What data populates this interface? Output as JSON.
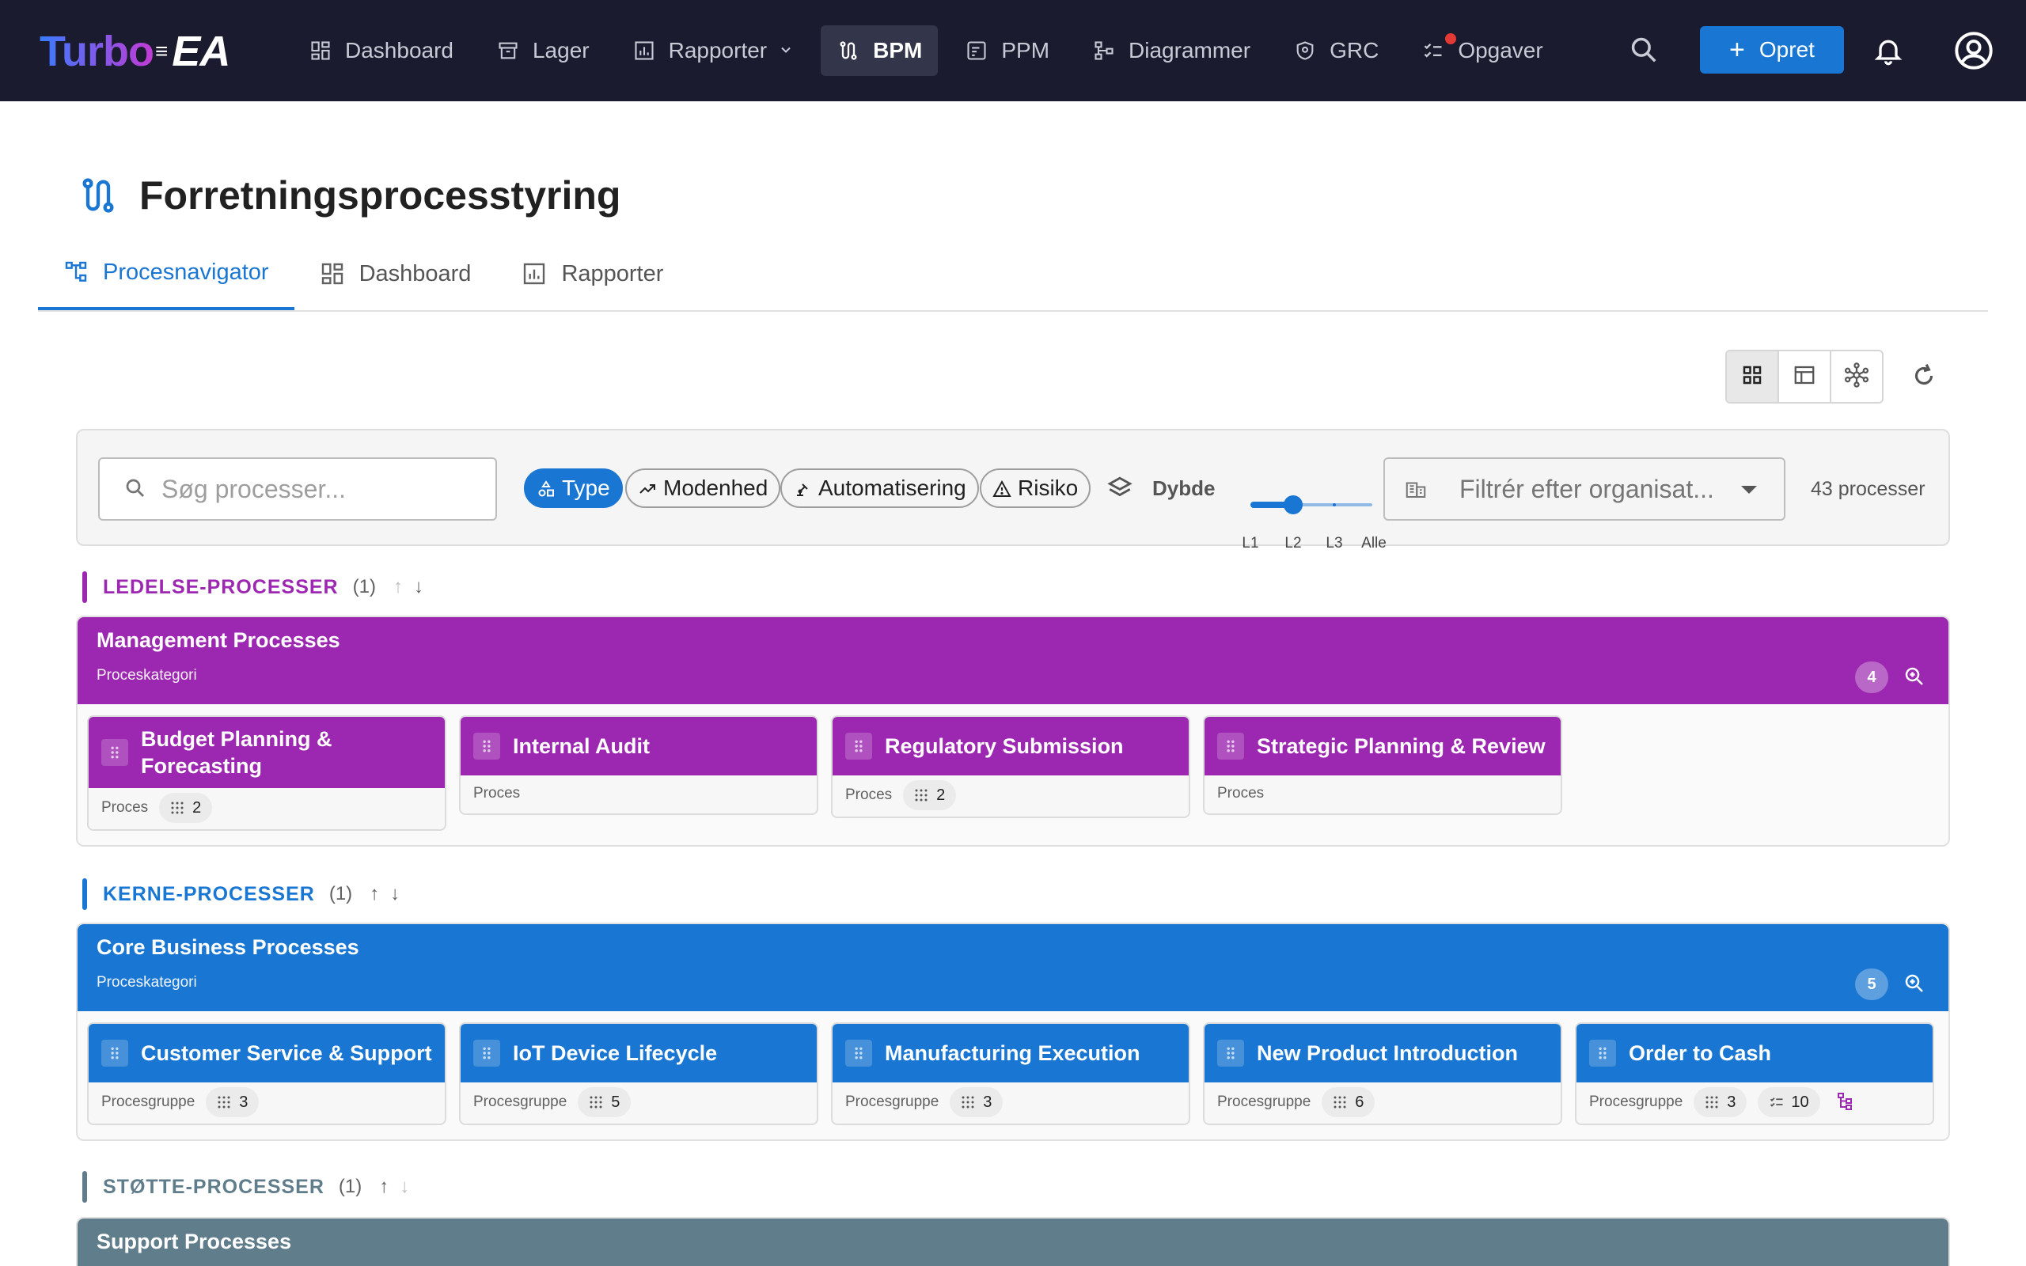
{
  "app": {
    "logo_part1": "Turbo",
    "logo_part2": "EA"
  },
  "nav": {
    "items": [
      {
        "label": "Dashboard",
        "icon": "dashboard-icon"
      },
      {
        "label": "Lager",
        "icon": "archive-icon"
      },
      {
        "label": "Rapporter",
        "icon": "report-icon"
      },
      {
        "label": "BPM",
        "icon": "bpm-route-icon"
      },
      {
        "label": "PPM",
        "icon": "ppm-icon"
      },
      {
        "label": "Diagrammer",
        "icon": "diagram-icon"
      },
      {
        "label": "GRC",
        "icon": "shield-icon"
      },
      {
        "label": "Opgaver",
        "icon": "tasks-icon"
      }
    ],
    "active": "BPM",
    "create_label": "Opret",
    "accent": "#1976d2"
  },
  "page": {
    "title": "Forretningsprocesstyring",
    "tabs": [
      {
        "label": "Procesnavigator"
      },
      {
        "label": "Dashboard"
      },
      {
        "label": "Rapporter"
      }
    ],
    "active_tab": "Procesnavigator"
  },
  "filters": {
    "search_placeholder": "Søg processer...",
    "chips": [
      "Type",
      "Modenhed",
      "Automatisering",
      "Risiko"
    ],
    "active_chip": "Type",
    "depth_label": "Dybde",
    "depth_levels": [
      "L1",
      "L2",
      "L3",
      "Alle"
    ],
    "depth_selected": "L2",
    "org_placeholder": "Filtrér efter organisat...",
    "count": "43 processer"
  },
  "sections": [
    {
      "name": "LEDELSE-PROCESSER",
      "count": "(1)",
      "color": "#9c27b0",
      "category": {
        "title": "Management Processes",
        "subtitle": "Proceskategori",
        "badge": "4",
        "cards": [
          {
            "title": "Budget Planning & Forecasting",
            "type": "Proces",
            "children": "2"
          },
          {
            "title": "Internal Audit",
            "type": "Proces"
          },
          {
            "title": "Regulatory Submission",
            "type": "Proces",
            "children": "2"
          },
          {
            "title": "Strategic Planning & Review",
            "type": "Proces"
          }
        ]
      }
    },
    {
      "name": "KERNE-PROCESSER",
      "count": "(1)",
      "color": "#1976d2",
      "category": {
        "title": "Core Business Processes",
        "subtitle": "Proceskategori",
        "badge": "5",
        "cards": [
          {
            "title": "Customer Service & Support",
            "type": "Procesgruppe",
            "children": "3"
          },
          {
            "title": "IoT Device Lifecycle",
            "type": "Procesgruppe",
            "children": "5"
          },
          {
            "title": "Manufacturing Execution",
            "type": "Procesgruppe",
            "children": "3"
          },
          {
            "title": "New Product Introduction",
            "type": "Procesgruppe",
            "children": "6"
          },
          {
            "title": "Order to Cash",
            "type": "Procesgruppe",
            "children": "3",
            "tasks": "10"
          }
        ]
      }
    },
    {
      "name": "STØTTE-PROCESSER",
      "count": "(1)",
      "color": "#607d8b",
      "category": {
        "title": "Support Processes"
      }
    }
  ]
}
